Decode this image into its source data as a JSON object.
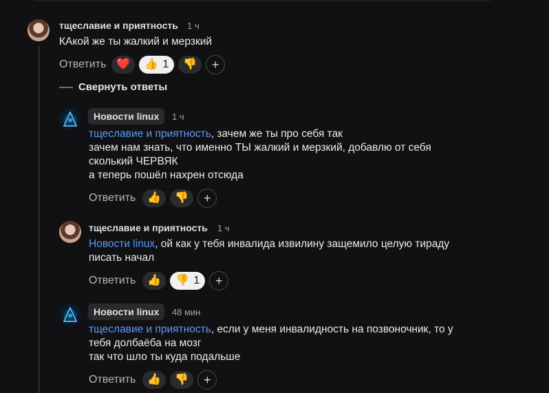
{
  "thread": {
    "collapse_label": "Свернуть ответы",
    "reply_label": "Ответить",
    "add_reaction": "+"
  },
  "comments": [
    {
      "author": "тщеславие и приятность",
      "time": "1 ч",
      "lines": [
        "КАкой же ты жалкий и мерзкий"
      ],
      "mention": "",
      "mention_rest": "",
      "reactions": [
        {
          "emoji": "❤️",
          "count": ""
        },
        {
          "emoji": "👍",
          "count": "1"
        },
        {
          "emoji": "👎",
          "count": ""
        }
      ]
    },
    {
      "author": "Новости linux",
      "time": "1 ч",
      "mention": "тщеславие и приятность",
      "mention_rest": ", зачем же ты про себя так",
      "lines": [
        "зачем нам знать, что именно ТЫ жалкий и мерзкий, добавлю от себя",
        "сколький ЧЕРВЯК",
        "а теперь пошёл нахрен отсюда"
      ],
      "reactions": [
        {
          "emoji": "👍",
          "count": ""
        },
        {
          "emoji": "👎",
          "count": ""
        }
      ]
    },
    {
      "author": "тщеславие и приятность",
      "time": "1 ч",
      "mention": "Новости linux",
      "mention_rest": ", ой как у тебя инвалида извилину защемило целую тираду",
      "lines": [
        "писать начал"
      ],
      "reactions": [
        {
          "emoji": "👍",
          "count": ""
        },
        {
          "emoji": "👎",
          "count": "1"
        }
      ]
    },
    {
      "author": "Новости linux",
      "time": "48 мин",
      "mention": "тщеславие и приятность",
      "mention_rest": ", если у меня инвалидность на позвоночник, то у",
      "lines": [
        "тебя долбаёба на мозг",
        "так что шло ты куда подальше"
      ],
      "reactions": [
        {
          "emoji": "👍",
          "count": ""
        },
        {
          "emoji": "👎",
          "count": ""
        }
      ]
    }
  ]
}
